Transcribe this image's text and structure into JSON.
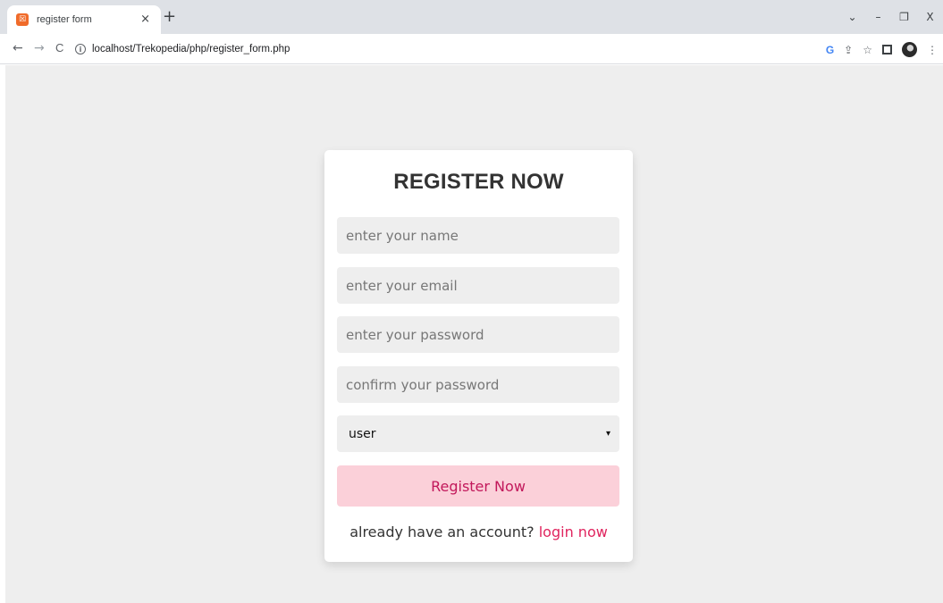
{
  "browser": {
    "tab_title": "register form",
    "tab_close": "×",
    "new_tab": "+",
    "url": "localhost/Trekopedia/php/register_form.php",
    "nav": {
      "back": "←",
      "forward": "→",
      "reload": "C"
    },
    "window_controls": {
      "dropdown": "⌄",
      "minimize": "–",
      "restore": "❐",
      "close": "X"
    },
    "toolbar_icons": [
      "google-icon",
      "share-icon",
      "star-icon",
      "side-panel-icon",
      "profile-avatar",
      "menu-icon"
    ]
  },
  "form": {
    "title": "REGISTER NOW",
    "name_placeholder": "enter your name",
    "email_placeholder": "enter your email",
    "password_placeholder": "enter your password",
    "confirm_placeholder": "confirm your password",
    "user_type": "user",
    "submit_label": "Register Now",
    "footer_text": "already have an account?",
    "footer_link": "login now"
  },
  "colors": {
    "page_bg": "#eeeeee",
    "card_bg": "#ffffff",
    "button_bg": "#fbd0d9",
    "button_text": "#c2185b",
    "link": "#e0245e"
  }
}
